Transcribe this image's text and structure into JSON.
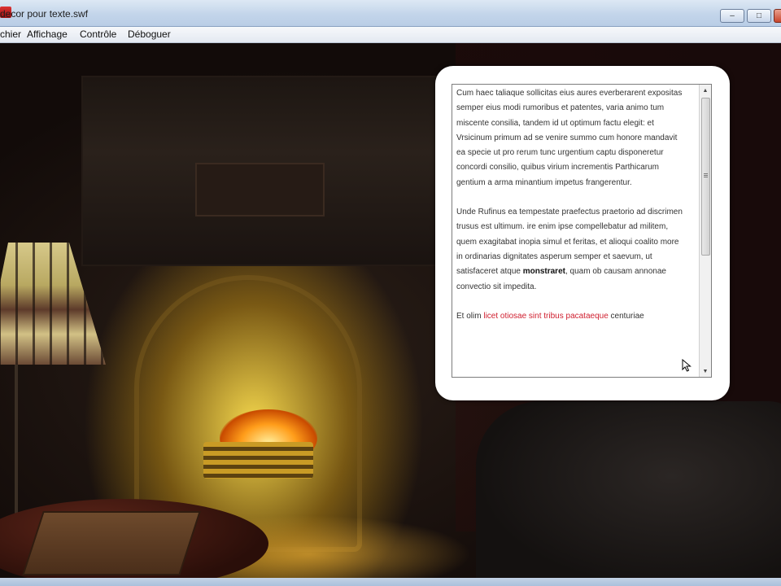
{
  "window": {
    "title": "decor pour texte.swf",
    "minimize": "–",
    "maximize": "□",
    "close": "✕"
  },
  "menu": {
    "items": [
      {
        "label": "chier"
      },
      {
        "label": "Affichage"
      },
      {
        "label": "Contrôle"
      },
      {
        "label": "Déboguer"
      }
    ]
  },
  "text_panel": {
    "paragraph1": "Cum haec taliaque sollicitas eius aures everberarent expositas semper eius modi rumoribus et patentes, varia animo tum miscente consilia, tandem id ut optimum factu elegit: et Vrsicinum primum ad se venire summo cum honore mandavit ea specie ut pro rerum tunc urgentium captu disponeretur concordi consilio, quibus virium incrementis Parthicarum gentium a arma minantium impetus frangerentur.",
    "paragraph2_start": "Unde Rufinus ea tempestate praefectus praetorio ad discrimen trusus est ultimum. ire enim ipse compellebatur ad militem, quem exagitabat inopia simul et feritas, et alioqui coalito more in ordinarias dignitates asperum semper et saevum, ut satisfaceret atque ",
    "paragraph2_bold": "monstraret",
    "paragraph2_end": ", quam ob causam annonae convectio sit impedita.",
    "paragraph3_start": "Et olim ",
    "paragraph3_link": "licet otiosae sint tribus pacataeque",
    "paragraph3_end": " centuriae",
    "scroll_up": "▲",
    "scroll_down": "▼"
  },
  "icons": {
    "app": "flash-player-icon",
    "cursor": "mouse-pointer-icon"
  },
  "colors": {
    "link_red": "#d02030",
    "titlebar": "#c3d5ea"
  }
}
